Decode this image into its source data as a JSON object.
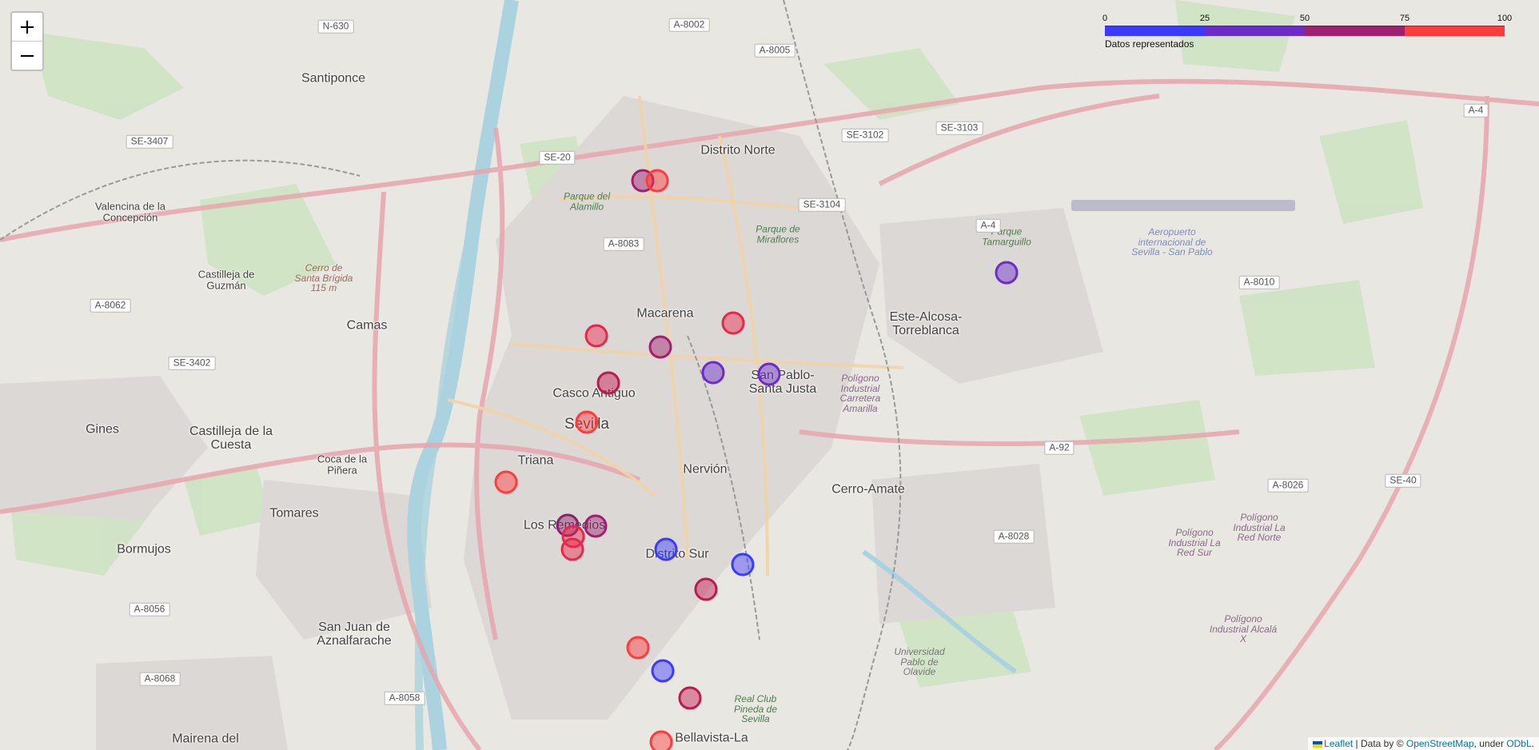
{
  "zoom": {
    "in_label": "+",
    "out_label": "−"
  },
  "legend": {
    "caption": "Datos representados",
    "ticks": [
      "0",
      "25",
      "50",
      "75",
      "100"
    ],
    "colors": [
      "#3b3bff",
      "#6b2cc9",
      "#a0206f",
      "#ff3b3b"
    ]
  },
  "attribution": {
    "leaflet": "Leaflet",
    "data_by": "| Data by ©",
    "osm": "OpenStreetMap",
    "under": ", under",
    "odbl": "ODbL",
    "end": "."
  },
  "places": {
    "santiponce": "Santiponce",
    "valencina": "Valencina de la Concepción",
    "castilleja_guzman": "Castilleja de Guzmán",
    "camas": "Camas",
    "gines": "Gines",
    "castilleja_cuesta": "Castilleja de la Cuesta",
    "coca_pinera": "Coca de la Piñera",
    "tomares": "Tomares",
    "bormujos": "Bormujos",
    "san_juan": "San Juan de Aznalfarache",
    "mairena": "Mairena del",
    "distrito_norte": "Distrito Norte",
    "macarena": "Macarena",
    "casco_antiguo": "Casco Antiguo",
    "sevilla": "Sevilla",
    "triana": "Triana",
    "nervion": "Nervión",
    "san_pablo": "San Pablo-Santa Justa",
    "los_remedios": "Los Remedios",
    "distrito_sur": "Distrito Sur",
    "cerro_amate": "Cerro-Amate",
    "este_alcosa": "Este-Alcosa-Torreblanca",
    "bellavista": "Bellavista-La"
  },
  "green_labels": {
    "alamillo": "Parque del Alamillo",
    "miraflores": "Parque de Miraflores",
    "tamarguillo": "Parque Tamarguillo",
    "cerro_brigida": "Cerro de Santa Brígida 115 m",
    "poligono_amarilla": "Polígono Industrial Carretera Amarilla",
    "red_norte": "Polígono Industrial La Red Norte",
    "red_sur": "Polígono Industrial La Red Sur",
    "alcala_x": "Polígono Industrial Alcalá X",
    "universidad": "Universidad Pablo de Olavide",
    "real_club": "Real Club Pineda de Sevilla",
    "aeropuerto": "Aeropuerto internacional de Sevilla - San Pablo"
  },
  "roads": {
    "n630": "N-630",
    "a8002": "A-8002",
    "a8005": "A-8005",
    "se3407": "SE-3407",
    "se20": "SE-20",
    "se3102": "SE-3102",
    "se3103": "SE-3103",
    "se3104": "SE-3104",
    "a8083": "A-8083",
    "a8062": "A-8062",
    "se3402": "SE-3402",
    "a4_a": "A-4",
    "a4_b": "A-4",
    "a8010": "A-8010",
    "a92": "A-92",
    "a8026": "A-8026",
    "se40": "SE-40",
    "a8028": "A-8028",
    "a8056": "A-8056",
    "a8068": "A-8068",
    "a8058": "A-8058"
  },
  "markers": [
    {
      "v": 70,
      "c": "#a0206f"
    },
    {
      "v": 95,
      "c": "#ff3b3b"
    },
    {
      "v": 45,
      "c": "#6b2cc9"
    },
    {
      "v": 85,
      "c": "#e8284a"
    },
    {
      "v": 90,
      "c": "#e8284a"
    },
    {
      "v": 75,
      "c": "#a0206f"
    },
    {
      "v": 80,
      "c": "#c0184f"
    },
    {
      "v": 40,
      "c": "#6b2cc9"
    },
    {
      "v": 45,
      "c": "#6b2cc9"
    },
    {
      "v": 98,
      "c": "#ff3b3b"
    },
    {
      "v": 98,
      "c": "#ff3b3b"
    },
    {
      "v": 60,
      "c": "#8a1f6a"
    },
    {
      "v": 70,
      "c": "#a0206f"
    },
    {
      "v": 88,
      "c": "#e8284a"
    },
    {
      "v": 85,
      "c": "#e8284a"
    },
    {
      "v": 10,
      "c": "#3b3bff"
    },
    {
      "v": 15,
      "c": "#3b3bff"
    },
    {
      "v": 78,
      "c": "#c0184f"
    },
    {
      "v": 95,
      "c": "#ff3b3b"
    },
    {
      "v": 10,
      "c": "#3b3bff"
    },
    {
      "v": 82,
      "c": "#c0184f"
    },
    {
      "v": 95,
      "c": "#ff3b3b"
    }
  ]
}
